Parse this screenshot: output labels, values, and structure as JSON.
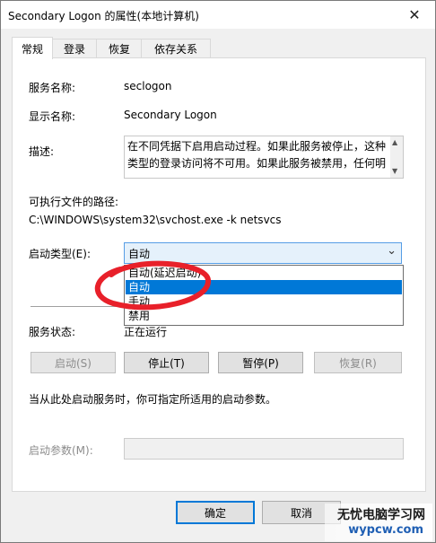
{
  "window": {
    "title": "Secondary Logon 的属性(本地计算机)",
    "close_glyph": "✕"
  },
  "tabs": [
    {
      "label": "常规",
      "active": true
    },
    {
      "label": "登录",
      "active": false
    },
    {
      "label": "恢复",
      "active": false
    },
    {
      "label": "依存关系",
      "active": false
    }
  ],
  "general": {
    "service_name_label": "服务名称:",
    "service_name_value": "seclogon",
    "display_name_label": "显示名称:",
    "display_name_value": "Secondary Logon",
    "description_label": "描述:",
    "description_value": "在不同凭据下启用启动过程。如果此服务被停止，这种类型的登录访问将不可用。如果此服务被禁用，任何明",
    "path_label": "可执行文件的路径:",
    "path_value": "C:\\WINDOWS\\system32\\svchost.exe -k netsvcs",
    "startup_type_label": "启动类型(E):",
    "startup_type_value": "自动",
    "startup_options": [
      "自动(延迟启动)",
      "自动",
      "手动",
      "禁用"
    ],
    "startup_selected_index": 1,
    "status_label": "服务状态:",
    "status_value": "正在运行",
    "start_button": "启动(S)",
    "stop_button": "停止(T)",
    "pause_button": "暂停(P)",
    "resume_button": "恢复(R)",
    "hint_text": "当从此处启动服务时，你可指定所适用的启动参数。",
    "param_label": "启动参数(M):",
    "param_value": ""
  },
  "dialog_buttons": {
    "ok": "确定",
    "cancel": "取消"
  },
  "watermark": {
    "line1": "无忧电脑学习网",
    "line2": "wypcw.com"
  },
  "colors": {
    "accent": "#0078d7",
    "annotation": "#e8202a"
  },
  "icons": {
    "close": "close-icon",
    "dropdown": "chevron-down-icon"
  }
}
